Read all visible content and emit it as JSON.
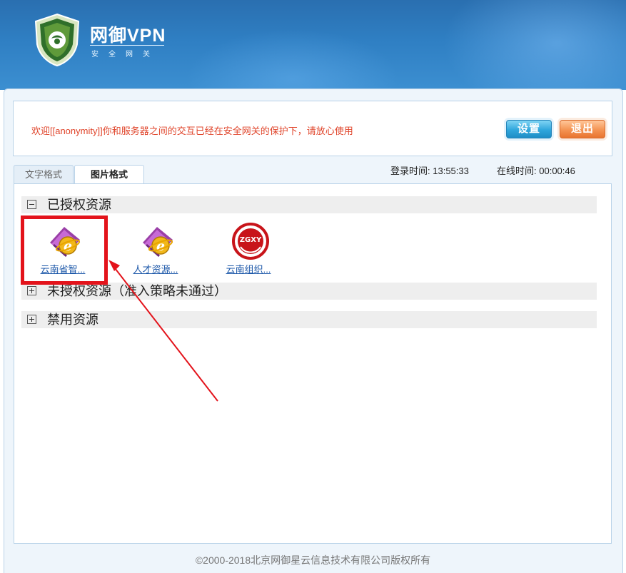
{
  "brand": {
    "title": "网御VPN",
    "subtitle": "安全网关"
  },
  "welcome": {
    "message": "欢迎[[anonymity]]你和服务器之间的交互已经在安全网关的保护下，请放心使用"
  },
  "buttons": {
    "settings": "设置",
    "logout": "退出"
  },
  "tabs": [
    {
      "label": "文字格式",
      "active": false
    },
    {
      "label": "图片格式",
      "active": true
    }
  ],
  "session": {
    "login_label": "登录时间:",
    "login_time": "13:55:33",
    "online_label": "在线时间:",
    "online_time": "00:00:46"
  },
  "sections": [
    {
      "label": "已授权资源",
      "expanded": true
    },
    {
      "label": "未授权资源（准入策略未通过）",
      "expanded": false
    },
    {
      "label": "禁用资源",
      "expanded": false
    }
  ],
  "resources": [
    {
      "label": "云南省智...",
      "icon": "ie-folder-icon"
    },
    {
      "label": "人才资源...",
      "icon": "ie-folder-icon"
    },
    {
      "label": "云南组织...",
      "icon": "zgxy-logo-icon",
      "logo_text": "ZGXY"
    }
  ],
  "footer": {
    "copyright": "©2000-2018北京网御星云信息技术有限公司版权所有"
  },
  "colors": {
    "header_blue": "#2f7fc3",
    "welcome_text": "#e0452b",
    "link": "#1a56a8",
    "highlight": "#e3131b"
  }
}
